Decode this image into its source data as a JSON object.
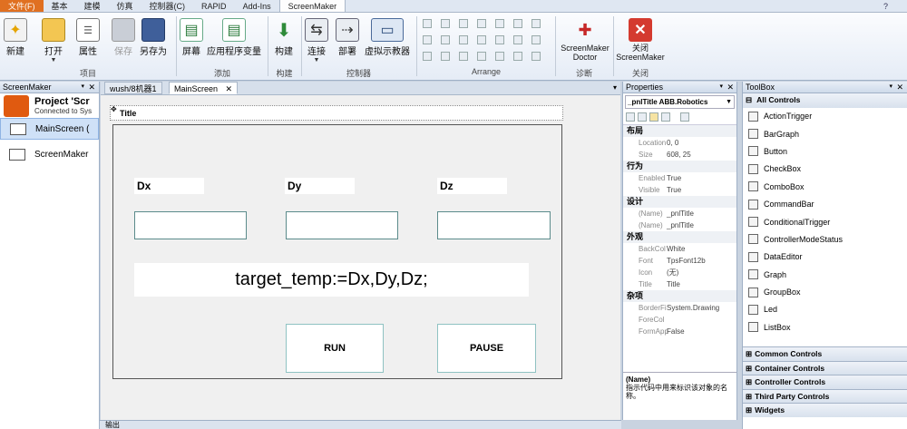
{
  "menubar": {
    "tabs": [
      "文件(F)",
      "基本",
      "建模",
      "仿真",
      "控制器(C)",
      "RAPID",
      "Add-Ins",
      "ScreenMaker"
    ],
    "active_tab": "ScreenMaker"
  },
  "ribbon": {
    "buttons": {
      "new": "新建",
      "open": "打开",
      "properties": "属性",
      "save": "保存",
      "save_as": "另存为",
      "screen": "屏幕",
      "app_var": "应用程序变量",
      "build": "构建",
      "connect": "连接",
      "deploy": "部署",
      "virtual_fp": "虚拟示教器",
      "doctor": "ScreenMaker Doctor",
      "close": "关闭 ScreenMaker"
    },
    "groups": {
      "project": "项目",
      "add": "添加",
      "build": "构建",
      "controller": "控制器",
      "arrange": "Arrange",
      "diagnose": "诊断",
      "close": "关闭"
    }
  },
  "left_panel": {
    "title": "ScreenMaker",
    "project_name": "Project 'Scr",
    "project_status": "Connected to Sys",
    "items": [
      "MainScreen (",
      "ScreenMaker"
    ]
  },
  "doc_tabs": [
    "wush/8机器1",
    "MainScreen"
  ],
  "canvas": {
    "title_label": "Title",
    "labels": {
      "dx": "Dx",
      "dy": "Dy",
      "dz": "Dz"
    },
    "expression": "target_temp:=Dx,Dy,Dz;",
    "run_button": "RUN",
    "pause_button": "PAUSE"
  },
  "properties": {
    "title": "Properties",
    "object": "_pnlTitle ABB.Robotics",
    "sections": [
      {
        "name": "布局",
        "rows": [
          [
            "Location",
            "0, 0"
          ],
          [
            "Size",
            "608, 25"
          ]
        ]
      },
      {
        "name": "行为",
        "rows": [
          [
            "Enabled",
            "True"
          ],
          [
            "Visible",
            "True"
          ]
        ]
      },
      {
        "name": "设计",
        "rows": [
          [
            "(Name)",
            "_pnlTitle"
          ],
          [
            "(Name)",
            "_pnlTitle"
          ]
        ]
      },
      {
        "name": "外观",
        "rows": [
          [
            "BackCol",
            "White"
          ],
          [
            "Font",
            "TpsFont12b"
          ],
          [
            "Icon",
            "(无)"
          ],
          [
            "Title",
            "Title"
          ]
        ]
      },
      {
        "name": "杂项",
        "rows": [
          [
            "BorderFi",
            "System.Drawing"
          ],
          [
            "ForeCol",
            ""
          ],
          [
            "FormApp",
            "False"
          ]
        ]
      }
    ],
    "desc_title": "(Name)",
    "desc_text": "指示代码中用来标识该对象的名称。"
  },
  "toolbox": {
    "title": "ToolBox",
    "all_controls": "All Controls",
    "items": [
      "ActionTrigger",
      "BarGraph",
      "Button",
      "CheckBox",
      "ComboBox",
      "CommandBar",
      "ConditionalTrigger",
      "ControllerModeStatus",
      "DataEditor",
      "Graph",
      "GroupBox",
      "Led",
      "ListBox"
    ],
    "sections": [
      "Common Controls",
      "Container Controls",
      "Controller Controls",
      "Third Party Controls",
      "Widgets"
    ]
  },
  "bottom": {
    "label": "输出"
  }
}
